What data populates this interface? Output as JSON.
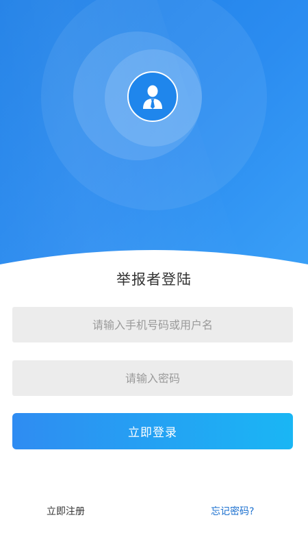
{
  "page": {
    "title": "举报者登陆"
  },
  "form": {
    "phone_placeholder": "请输入手机号码或用户名",
    "password_placeholder": "请输入密码",
    "login_label": "立即登录"
  },
  "footer": {
    "register_label": "立即注册",
    "forgot_label": "忘记密码?"
  },
  "icons": {
    "avatar": "user-tie-icon"
  },
  "colors": {
    "header_blue": "#2b8cf0",
    "button_start": "#2f8cf2",
    "button_end": "#1ab6f4",
    "link_blue": "#1a6fcf",
    "field_bg": "#ececec"
  }
}
